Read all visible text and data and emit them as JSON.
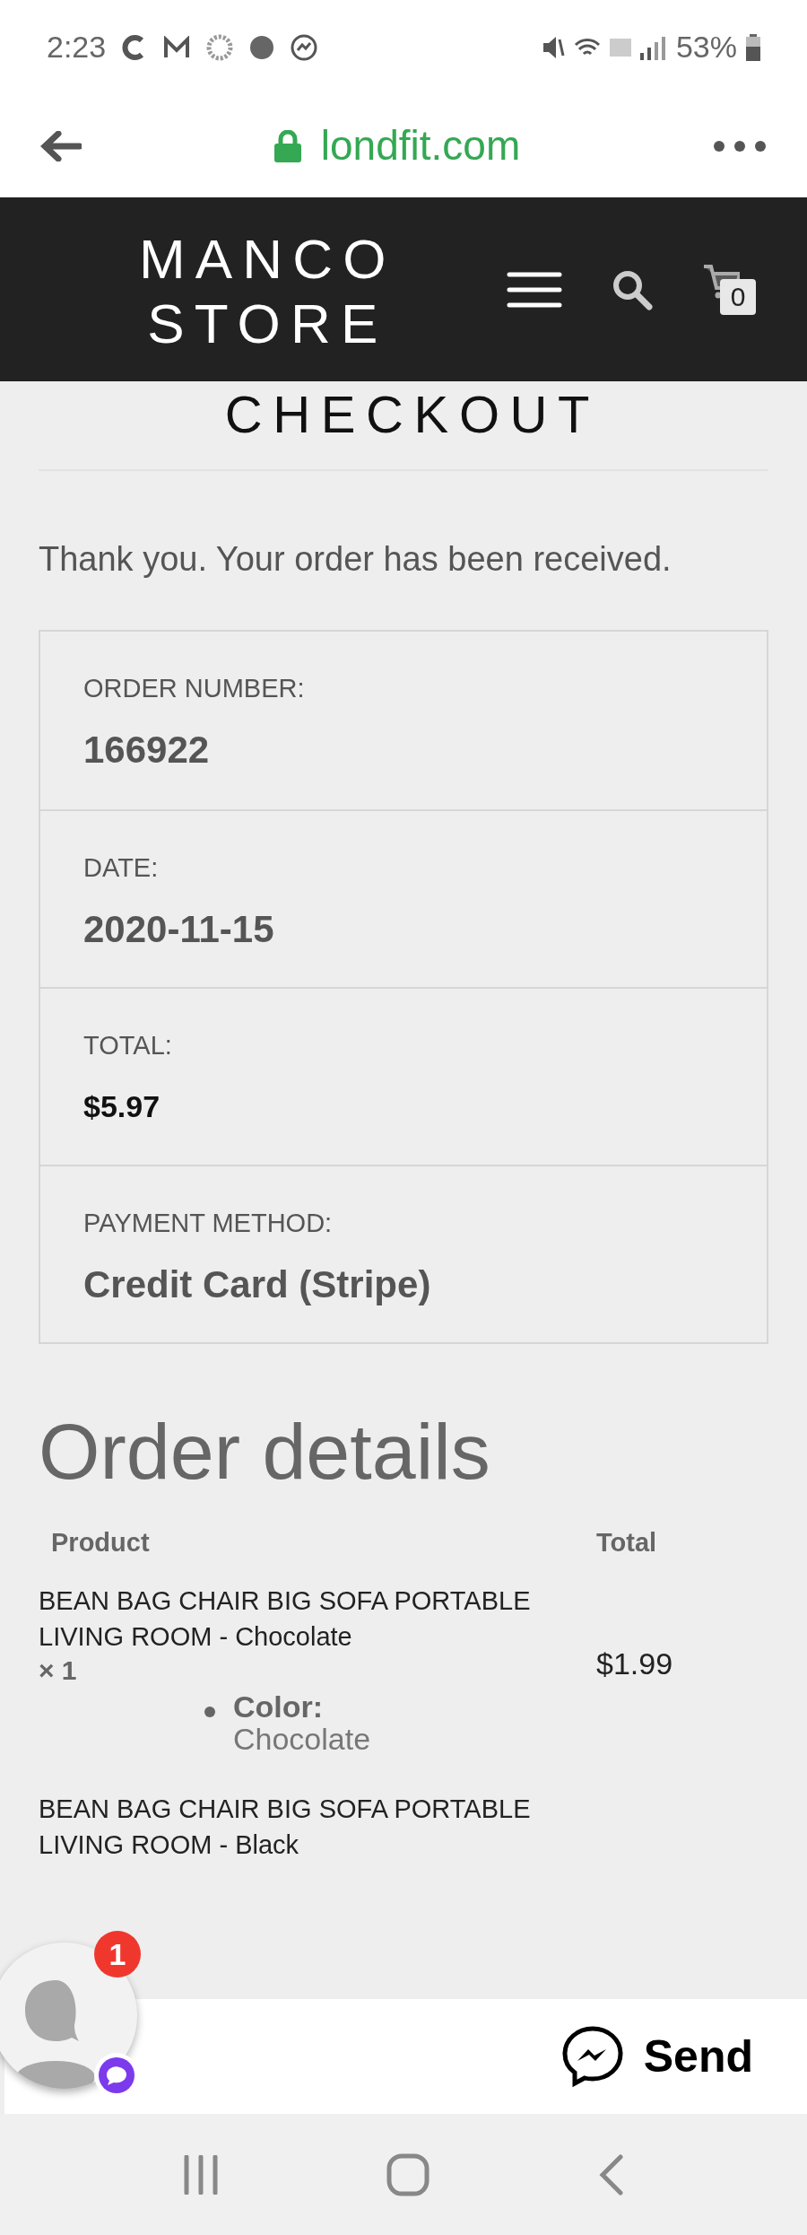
{
  "status_bar": {
    "time": "2:23",
    "battery": "53%"
  },
  "browser": {
    "url": "londfit.com"
  },
  "header": {
    "logo_lines": [
      "MANCO",
      "STORE"
    ],
    "cart_count": "0"
  },
  "page_title": "CHECKOUT",
  "notice": "Thank you. Your order has been received.",
  "overview": [
    {
      "label": "ORDER NUMBER:",
      "value": "166922",
      "kind": "large"
    },
    {
      "label": "DATE:",
      "value": "2020-11-15",
      "kind": "large"
    },
    {
      "label": "TOTAL:",
      "value": "$5.97",
      "kind": "amount"
    },
    {
      "label": "PAYMENT METHOD:",
      "value": "Credit Card (Stripe)",
      "kind": "large"
    }
  ],
  "order_details": {
    "heading": "Order details",
    "columns": [
      "Product",
      "Total"
    ],
    "rows": [
      {
        "name": "BEAN BAG CHAIR BIG SOFA PORTABLE LIVING ROOM - Chocolate",
        "quantity": "× 1",
        "meta_label": "Color:",
        "meta_value": "Chocolate",
        "total": "$1.99"
      },
      {
        "name": "BEAN BAG CHAIR BIG SOFA PORTABLE LIVING ROOM - Black"
      }
    ]
  },
  "chat": {
    "unread": "1",
    "button": "Send"
  }
}
